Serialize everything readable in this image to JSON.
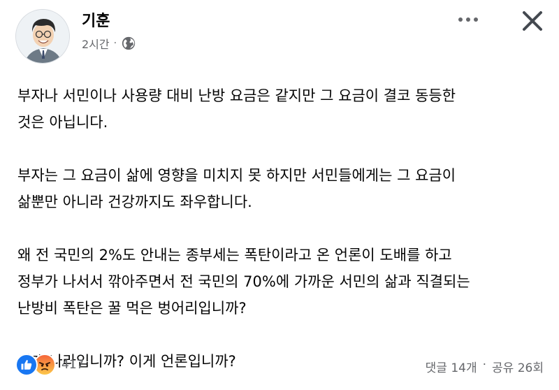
{
  "post": {
    "author": "기훈",
    "time": "2시간",
    "separator": "·",
    "privacy_icon": "globe-icon",
    "paragraphs": [
      [
        "부자나 서민이나 사용량 대비 난방 요금은 같지만 그 요금이 결코 동등한",
        "것은 아닙니다."
      ],
      [
        "부자는 그 요금이 삶에 영향을 미치지 못 하지만 서민들에게는 그 요금이",
        "삶뿐만 아니라 건강까지도 좌우합니다."
      ],
      [
        "왜 전 국민의 2%도 안내는 종부세는 폭탄이라고 온 언론이 도배를 하고",
        "정부가 나서서 깎아주면서 전 국민의 70%에 가까운 서민의 삶과 직결되는",
        "난방비 폭탄은 꿀 먹은 벙어리입니까?"
      ],
      [
        "이게 나라입니까? 이게 언론입니까?"
      ]
    ],
    "reactions": {
      "icons": [
        "like-icon",
        "angry-icon"
      ],
      "count": "417"
    },
    "comments": "댓글 14개",
    "stats_separator": "·",
    "shares": "공유 26회"
  },
  "colors": {
    "text_primary": "#050505",
    "text_secondary": "#65676b",
    "like_blue": "#1877f2"
  }
}
